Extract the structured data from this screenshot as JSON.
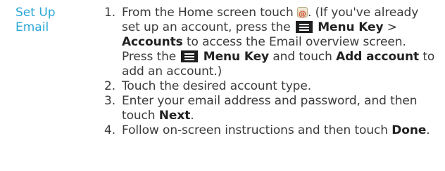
{
  "section": {
    "title_line1": "Set Up",
    "title_line2": "Email"
  },
  "steps": [
    {
      "num": "1.",
      "t1": "From the Home screen touch",
      "t2": ". (If you've already set up an account, press the",
      "b1": "Menu Key",
      "t3": " > ",
      "b2": "Accounts",
      "t4": " to access the Email overview screen. Press the",
      "b3": "Menu Key",
      "t5": " and touch ",
      "b4": "Add account",
      "t6": " to add an account.)"
    },
    {
      "num": "2.",
      "t1": "Touch the desired account type."
    },
    {
      "num": "3.",
      "t1": "Enter your email address and password, and then touch ",
      "b1": "Next",
      "t2": "."
    },
    {
      "num": "4.",
      "t1": "Follow on-screen instructions and then touch ",
      "b1": "Done",
      "t2": "."
    }
  ],
  "icons": {
    "email_app": "email-app-icon",
    "menu_key": "menu-key-icon"
  },
  "colors": {
    "heading": "#2aa7d8",
    "body_text": "#3a3a3a"
  }
}
